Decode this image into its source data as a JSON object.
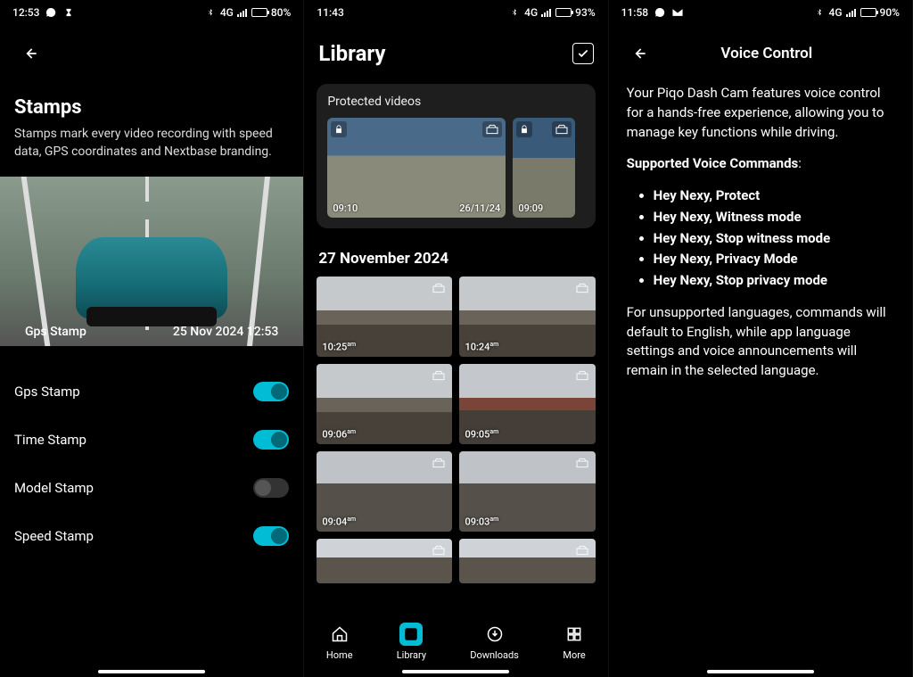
{
  "screen1": {
    "status": {
      "time": "12:53",
      "network_label": "4G",
      "battery_pct": "80%"
    },
    "title": "Stamps",
    "desc": "Stamps mark every video recording with speed data, GPS coordinates and Nextbase branding.",
    "hero_left": "Gps Stamp",
    "hero_right": "25 Nov 2024 12:53",
    "toggles": [
      {
        "label": "Gps Stamp",
        "on": true
      },
      {
        "label": "Time Stamp",
        "on": true
      },
      {
        "label": "Model Stamp",
        "on": false
      },
      {
        "label": "Speed Stamp",
        "on": true
      }
    ]
  },
  "screen2": {
    "status": {
      "time": "11:43",
      "network_label": "4G",
      "battery_pct": "93%"
    },
    "title": "Library",
    "protected_title": "Protected videos",
    "protected_main": {
      "left_time": "09:10",
      "date": "26/11/24"
    },
    "protected_side": {
      "time": "09:09"
    },
    "section_date": "27 November 2024",
    "thumbs": [
      {
        "time": "10:25",
        "suffix": "am"
      },
      {
        "time": "10:24",
        "suffix": "am"
      },
      {
        "time": "09:06",
        "suffix": "am"
      },
      {
        "time": "09:05",
        "suffix": "am"
      },
      {
        "time": "09:04",
        "suffix": "am"
      },
      {
        "time": "09:03",
        "suffix": "am"
      },
      {
        "time": "",
        "suffix": ""
      },
      {
        "time": "",
        "suffix": ""
      }
    ],
    "tabs": {
      "home": "Home",
      "library": "Library",
      "downloads": "Downloads",
      "more": "More"
    }
  },
  "screen3": {
    "status": {
      "time": "11:58",
      "network_label": "4G",
      "battery_pct": "90%"
    },
    "title": "Voice Control",
    "intro": "Your Piqo Dash Cam features voice control for a hands-free experience, allowing you to manage key functions while driving.",
    "supported_label": "Supported Voice Commands",
    "commands": [
      "Hey Nexy, Protect",
      "Hey Nexy, Witness mode",
      "Hey Nexy, Stop witness mode",
      "Hey Nexy, Privacy Mode",
      "Hey Nexy, Stop privacy mode"
    ],
    "footer": "For unsupported languages, commands will default to English, while app language settings and voice announcements will remain in the selected language."
  }
}
